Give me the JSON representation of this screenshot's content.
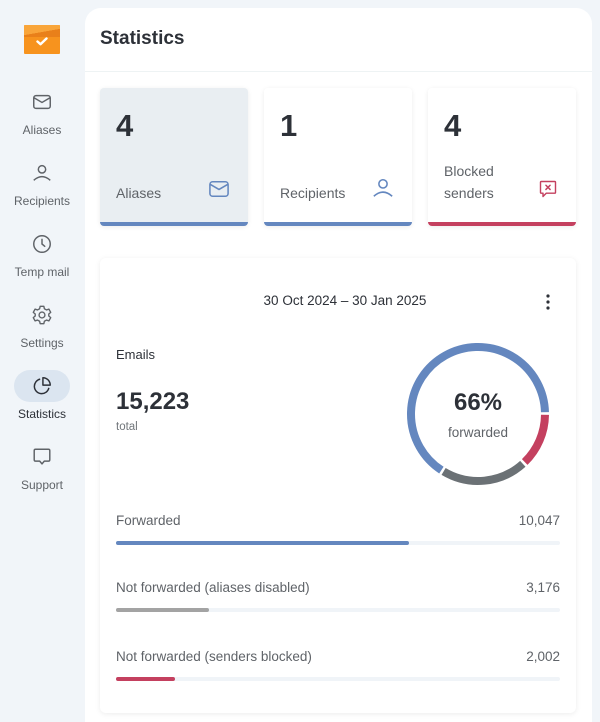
{
  "sidebar": {
    "logo": "mail-check-logo",
    "items": [
      {
        "label": "Aliases",
        "icon": "envelope-icon",
        "active": false
      },
      {
        "label": "Recipients",
        "icon": "person-icon",
        "active": false
      },
      {
        "label": "Temp mail",
        "icon": "clock-icon",
        "active": false
      },
      {
        "label": "Settings",
        "icon": "gear-icon",
        "active": false
      },
      {
        "label": "Statistics",
        "icon": "pie-chart-icon",
        "active": true
      },
      {
        "label": "Support",
        "icon": "chat-bubble-icon",
        "active": false
      }
    ]
  },
  "header": {
    "title": "Statistics"
  },
  "cards": [
    {
      "value": "4",
      "label": "Aliases",
      "icon": "envelope-icon",
      "color": "#6487bf"
    },
    {
      "value": "1",
      "label": "Recipients",
      "icon": "person-icon",
      "color": "#6487bf"
    },
    {
      "value": "4",
      "label": "Blocked senders",
      "icon": "blocked-message-icon",
      "color": "#c4405f"
    }
  ],
  "panel": {
    "date_range": "30 Oct 2024 – 30 Jan 2025",
    "section_label": "Emails",
    "total_value": "15,223",
    "total_label": "total",
    "donut": {
      "percent_label": "66%",
      "sub_label": "forwarded"
    },
    "rows": [
      {
        "label": "Forwarded",
        "value": "10,047",
        "fraction": 0.66,
        "color": "#6487bf"
      },
      {
        "label": "Not forwarded (aliases disabled)",
        "value": "3,176",
        "fraction": 0.209,
        "color": "#a3a3a3"
      },
      {
        "label": "Not forwarded (senders blocked)",
        "value": "2,002",
        "fraction": 0.132,
        "color": "#c4405f"
      }
    ]
  },
  "colors": {
    "forwarded": "#6487bf",
    "aliases_disabled": "#6b7175",
    "senders_blocked": "#c4405f",
    "accent_orange": "#f7931e"
  },
  "chart_data": {
    "type": "pie",
    "title": "Emails",
    "categories": [
      "Forwarded",
      "Not forwarded (aliases disabled)",
      "Not forwarded (senders blocked)"
    ],
    "values": [
      10047,
      3176,
      2002
    ],
    "total": 15223,
    "center_label": "66% forwarded"
  }
}
